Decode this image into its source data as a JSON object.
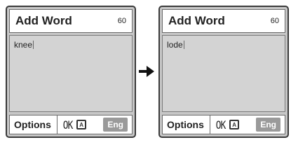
{
  "screens": [
    {
      "title": "Add Word",
      "char_count": "60",
      "text": "knee",
      "options_label": "Options",
      "ok_label": "OK",
      "mode_icon": "A",
      "lang_label": "Eng"
    },
    {
      "title": "Add Word",
      "char_count": "60",
      "text": "lode",
      "options_label": "Options",
      "ok_label": "OK",
      "mode_icon": "A",
      "lang_label": "Eng"
    }
  ],
  "arrow_icon": "right-arrow-icon"
}
